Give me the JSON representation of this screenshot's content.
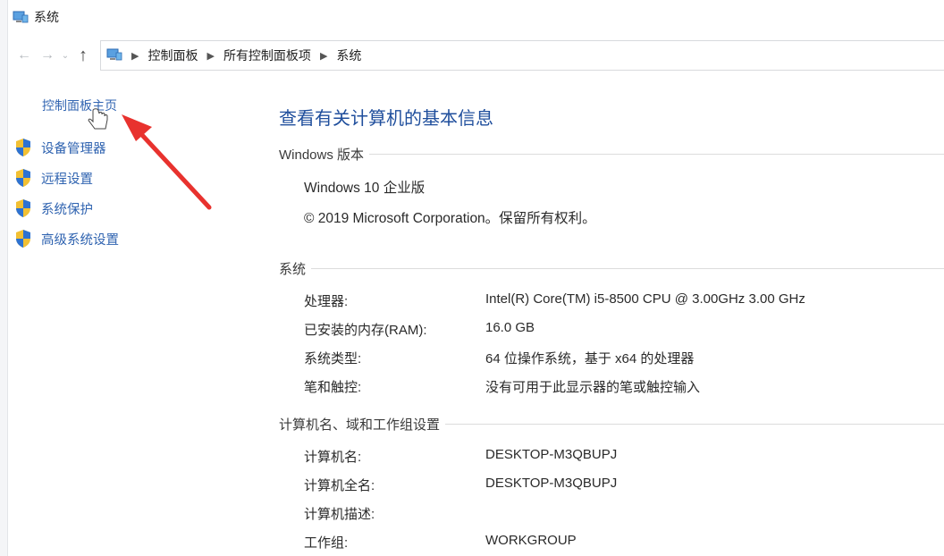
{
  "window": {
    "title": "系统"
  },
  "address": {
    "back_icon": "arrow-left-icon",
    "forward_icon": "arrow-right-icon",
    "up_icon": "arrow-up-icon",
    "crumbs": [
      "控制面板",
      "所有控制面板项",
      "系统"
    ]
  },
  "sidebar": {
    "home_link": "控制面板主页",
    "items": [
      {
        "label": "设备管理器",
        "icon": "shield-icon"
      },
      {
        "label": "远程设置",
        "icon": "shield-icon"
      },
      {
        "label": "系统保护",
        "icon": "shield-icon"
      },
      {
        "label": "高级系统设置",
        "icon": "shield-icon"
      }
    ]
  },
  "main": {
    "heading": "查看有关计算机的基本信息",
    "windows_edition": {
      "title": "Windows 版本",
      "edition": "Windows 10 企业版",
      "copyright": "© 2019 Microsoft Corporation。保留所有权利。"
    },
    "system": {
      "title": "系统",
      "rows": [
        {
          "key": "处理器:",
          "value": "Intel(R) Core(TM) i5-8500 CPU @ 3.00GHz   3.00 GHz"
        },
        {
          "key": "已安装的内存(RAM):",
          "value": "16.0 GB"
        },
        {
          "key": "系统类型:",
          "value": "64 位操作系统，基于 x64 的处理器"
        },
        {
          "key": "笔和触控:",
          "value": "没有可用于此显示器的笔或触控输入"
        }
      ]
    },
    "computer": {
      "title": "计算机名、域和工作组设置",
      "rows": [
        {
          "key": "计算机名:",
          "value": "DESKTOP-M3QBUPJ"
        },
        {
          "key": "计算机全名:",
          "value": "DESKTOP-M3QBUPJ"
        },
        {
          "key": "计算机描述:",
          "value": ""
        },
        {
          "key": "工作组:",
          "value": "WORKGROUP"
        }
      ]
    }
  },
  "colors": {
    "link": "#2f63b0",
    "heading": "#1f4e9c",
    "annotation_arrow": "#e8322e"
  }
}
